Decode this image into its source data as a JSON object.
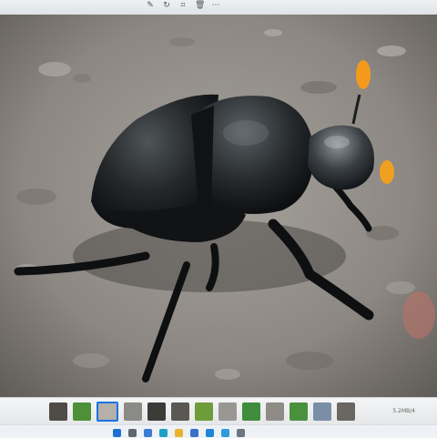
{
  "viewer": {
    "toolbar_icons": [
      "pencil-icon",
      "rotate-icon",
      "crop-icon",
      "delete-icon",
      "more-icon"
    ],
    "counter_text": "5.2MB/4"
  },
  "filmstrip": {
    "thumbnail_colors": [
      "#4f4c48",
      "#4e8f3a",
      "#b5b0a8",
      "#8c8a86",
      "#3d3b38",
      "#5b5853",
      "#6f9c3b",
      "#9a9793",
      "#3f8d3d",
      "#8f8c88",
      "#49913c",
      "#7a8fa6",
      "#6a6660"
    ],
    "active_index": 2
  },
  "taskbar": {
    "app_icons": [
      "windows-icon",
      "search-icon",
      "widgets-icon",
      "edge-icon",
      "explorer-icon",
      "store-icon",
      "mail-icon",
      "photos-icon",
      "settings-icon"
    ],
    "app_colors": [
      "#1f6fd1",
      "#5d6670",
      "#3b7bd4",
      "#1aa1c7",
      "#e8b430",
      "#3a71c9",
      "#1e86d6",
      "#2f9bd8",
      "#6b7580"
    ]
  }
}
